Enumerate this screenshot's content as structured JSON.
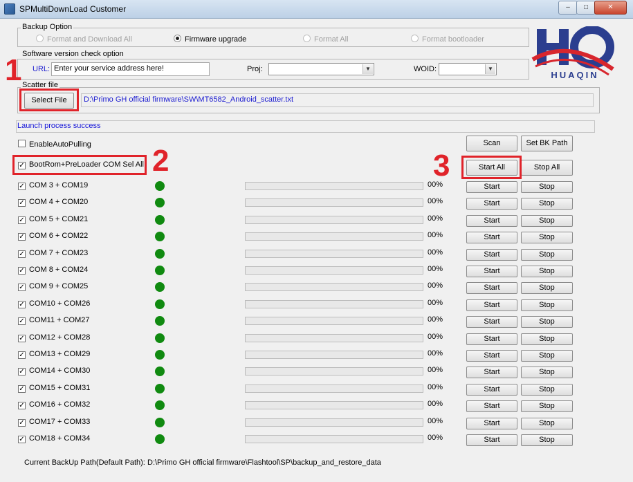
{
  "window": {
    "title": "SPMultiDownLoad Customer",
    "minimize": "–",
    "maximize": "□",
    "close": "✕"
  },
  "backup_option": {
    "label": "Backup Option",
    "options": [
      {
        "label": "Format and Download All",
        "selected": false,
        "enabled": false
      },
      {
        "label": "Firmware upgrade",
        "selected": true,
        "enabled": true
      },
      {
        "label": "Format All",
        "selected": false,
        "enabled": false
      },
      {
        "label": "Format bootloader",
        "selected": false,
        "enabled": false
      }
    ]
  },
  "version_check": {
    "label": "Software version check option",
    "url_label": "URL:",
    "url_value": "Enter your service address here!",
    "proj_label": "Proj:",
    "proj_value": "",
    "woid_label": "WOID:",
    "woid_value": ""
  },
  "scatter": {
    "label": "Scatter file",
    "select_button": "Select File",
    "path": "D:\\Primo GH official firmware\\SW\\MT6582_Android_scatter.txt"
  },
  "logo": {
    "text": "HUAQIN"
  },
  "status": "Launch process success",
  "controls": {
    "auto_pulling": "EnableAutoPulling",
    "select_all": "BootRom+PreLoader COM Sel All",
    "scan": "Scan",
    "set_bk_path": "Set BK Path",
    "start_all": "Start All",
    "stop_all": "Stop All"
  },
  "annotations": {
    "one": "1",
    "two": "2",
    "three": "3"
  },
  "ports": [
    {
      "label": "COM 3 + COM19",
      "checked": true,
      "progress": 0,
      "percent": "00%",
      "start": "Start",
      "stop": "Stop"
    },
    {
      "label": "COM 4 + COM20",
      "checked": true,
      "progress": 0,
      "percent": "00%",
      "start": "Start",
      "stop": "Stop"
    },
    {
      "label": "COM 5 + COM21",
      "checked": true,
      "progress": 0,
      "percent": "00%",
      "start": "Start",
      "stop": "Stop"
    },
    {
      "label": "COM 6 + COM22",
      "checked": true,
      "progress": 0,
      "percent": "00%",
      "start": "Start",
      "stop": "Stop"
    },
    {
      "label": "COM 7 + COM23",
      "checked": true,
      "progress": 0,
      "percent": "00%",
      "start": "Start",
      "stop": "Stop"
    },
    {
      "label": "COM 8 + COM24",
      "checked": true,
      "progress": 0,
      "percent": "00%",
      "start": "Start",
      "stop": "Stop"
    },
    {
      "label": "COM 9 + COM25",
      "checked": true,
      "progress": 0,
      "percent": "00%",
      "start": "Start",
      "stop": "Stop"
    },
    {
      "label": "COM10 + COM26",
      "checked": true,
      "progress": 0,
      "percent": "00%",
      "start": "Start",
      "stop": "Stop"
    },
    {
      "label": "COM11 + COM27",
      "checked": true,
      "progress": 0,
      "percent": "00%",
      "start": "Start",
      "stop": "Stop"
    },
    {
      "label": "COM12 + COM28",
      "checked": true,
      "progress": 0,
      "percent": "00%",
      "start": "Start",
      "stop": "Stop"
    },
    {
      "label": "COM13 + COM29",
      "checked": true,
      "progress": 0,
      "percent": "00%",
      "start": "Start",
      "stop": "Stop"
    },
    {
      "label": "COM14 + COM30",
      "checked": true,
      "progress": 0,
      "percent": "00%",
      "start": "Start",
      "stop": "Stop"
    },
    {
      "label": "COM15 + COM31",
      "checked": true,
      "progress": 0,
      "percent": "00%",
      "start": "Start",
      "stop": "Stop"
    },
    {
      "label": "COM16 + COM32",
      "checked": true,
      "progress": 0,
      "percent": "00%",
      "start": "Start",
      "stop": "Stop"
    },
    {
      "label": "COM17 + COM33",
      "checked": true,
      "progress": 0,
      "percent": "00%",
      "start": "Start",
      "stop": "Stop"
    },
    {
      "label": "COM18 + COM34",
      "checked": true,
      "progress": 0,
      "percent": "00%",
      "start": "Start",
      "stop": "Stop"
    }
  ],
  "footer": {
    "backup_label": "Current BackUp Path(Default Path):",
    "backup_path": "D:\\Primo GH official firmware\\Flashtool\\SP\\backup_and_restore_data"
  },
  "colors": {
    "annotation": "#e0232a",
    "status_text": "#1515d8",
    "led": "#108a10",
    "logo_blue": "#2b3e8f",
    "logo_red": "#d8262d"
  }
}
